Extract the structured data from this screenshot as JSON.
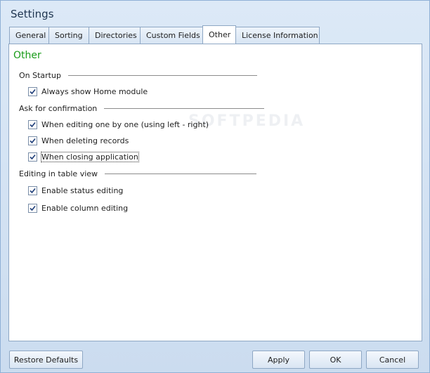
{
  "window": {
    "title": "Settings"
  },
  "tabs": [
    {
      "label": "General"
    },
    {
      "label": "Sorting"
    },
    {
      "label": "Directories"
    },
    {
      "label": "Custom Fields"
    },
    {
      "label": "Other",
      "active": true
    },
    {
      "label": "License Information"
    }
  ],
  "panel": {
    "title": "Other",
    "watermark": "SOFTPEDIA",
    "groups": [
      {
        "label": "On Startup",
        "options": [
          {
            "label": "Always show Home module",
            "checked": true
          }
        ]
      },
      {
        "label": "Ask for confirmation",
        "options": [
          {
            "label": "When editing one by one (using left - right)",
            "checked": true
          },
          {
            "label": "When deleting records",
            "checked": true
          },
          {
            "label": "When closing application",
            "checked": true,
            "focused": true
          }
        ]
      },
      {
        "label": "Editing in table view",
        "options": [
          {
            "label": "Enable status editing",
            "checked": true
          },
          {
            "label": "Enable column editing",
            "checked": true
          }
        ]
      }
    ]
  },
  "buttons": {
    "restore_defaults": "Restore Defaults",
    "apply": "Apply",
    "ok": "OK",
    "cancel": "Cancel"
  },
  "colors": {
    "accent_title": "#1a9c1a",
    "window_bg": "#cfe0f2"
  }
}
